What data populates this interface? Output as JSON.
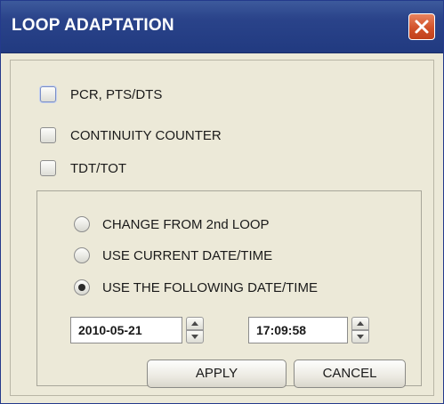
{
  "window": {
    "title": "LOOP ADAPTATION"
  },
  "checkboxes": [
    {
      "label": "PCR, PTS/DTS",
      "checked": false
    },
    {
      "label": "CONTINUITY COUNTER",
      "checked": false
    },
    {
      "label": "TDT/TOT",
      "checked": false
    }
  ],
  "radios": [
    {
      "label": "CHANGE FROM 2nd LOOP",
      "selected": false
    },
    {
      "label": "USE CURRENT DATE/TIME",
      "selected": false
    },
    {
      "label": "USE THE FOLLOWING DATE/TIME",
      "selected": true
    }
  ],
  "date_field": {
    "value": "2010-05-21"
  },
  "time_field": {
    "value": "17:09:58"
  },
  "buttons": {
    "apply": "APPLY",
    "cancel": "CANCEL"
  },
  "icons": {
    "close": "close-icon",
    "spin_up": "arrow-up-icon",
    "spin_down": "arrow-down-icon"
  },
  "colors": {
    "titlebar": "#2a438a",
    "close_button": "#d2522a",
    "dialog_bg": "#ece9d8"
  }
}
